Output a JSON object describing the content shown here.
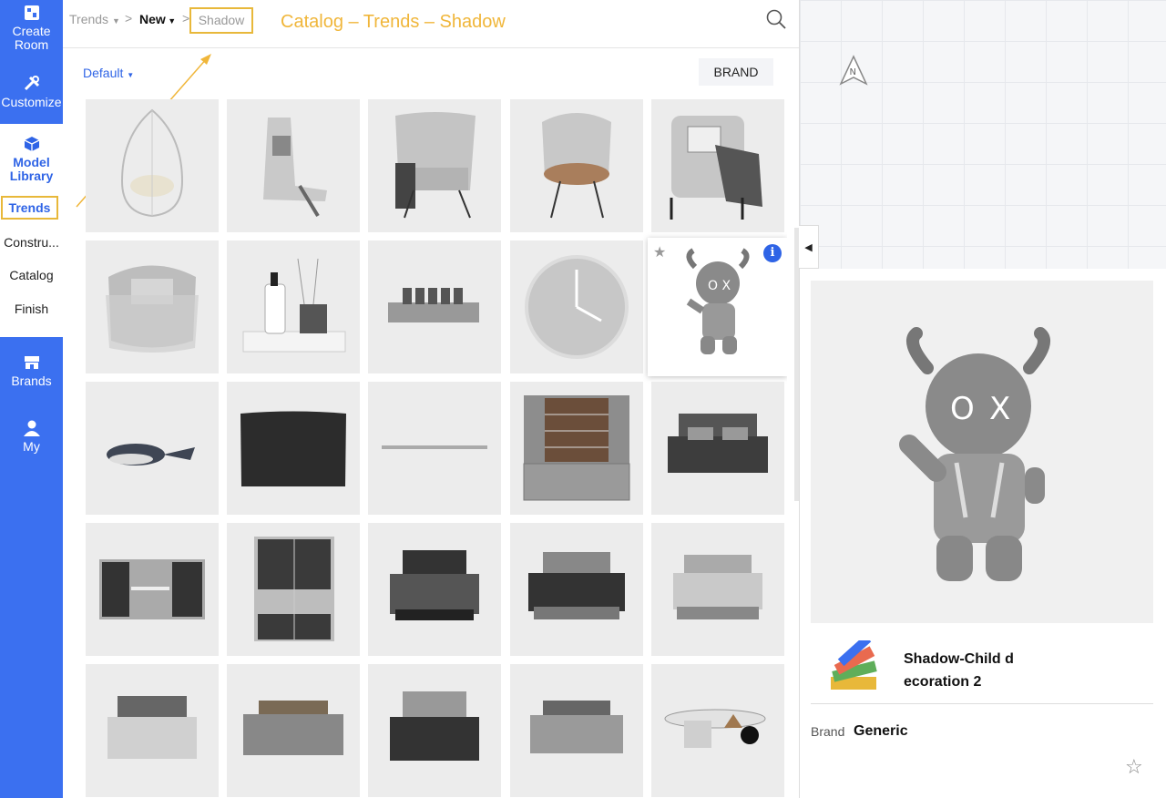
{
  "sidebar": {
    "create_room": [
      "Create",
      "Room"
    ],
    "customize": "Customize",
    "model_library": [
      "Model",
      "Library"
    ],
    "trends": "Trends",
    "construction": "Constru...",
    "catalog": "Catalog",
    "finish": "Finish",
    "brands": "Brands",
    "my": "My"
  },
  "header": {
    "breadcrumb": [
      "Trends",
      "New",
      "Shadow"
    ],
    "annotation": "Catalog – Trends – Shadow"
  },
  "toolbar": {
    "sort": "Default",
    "brand_button": "BRAND"
  },
  "grid_items": [
    "hanging-egg-chair",
    "lounge-chaise",
    "fabric-armchair",
    "shell-armchair",
    "wing-armchair",
    "pouf-armchair",
    "diffuser-tray",
    "nixie-clock",
    "wall-clock",
    "ox-figurine",
    "whale-plush",
    "black-rug",
    "shelf-plank",
    "wardrobe-bookcase",
    "double-bed",
    "wall-bookcase-desk",
    "tall-bookcase",
    "dark-bed",
    "grey-bed",
    "upholstered-bed",
    "bed-nightstands",
    "low-bed",
    "tufted-bed",
    "platform-bed",
    "coffee-table-set"
  ],
  "detail": {
    "title": [
      "Shadow-Child d",
      "ecoration 2"
    ],
    "brand_label": "Brand",
    "brand_value": "Generic"
  },
  "colors": {
    "accent": "#3b70f0",
    "highlight": "#e8b83a",
    "link": "#2f64e6"
  }
}
